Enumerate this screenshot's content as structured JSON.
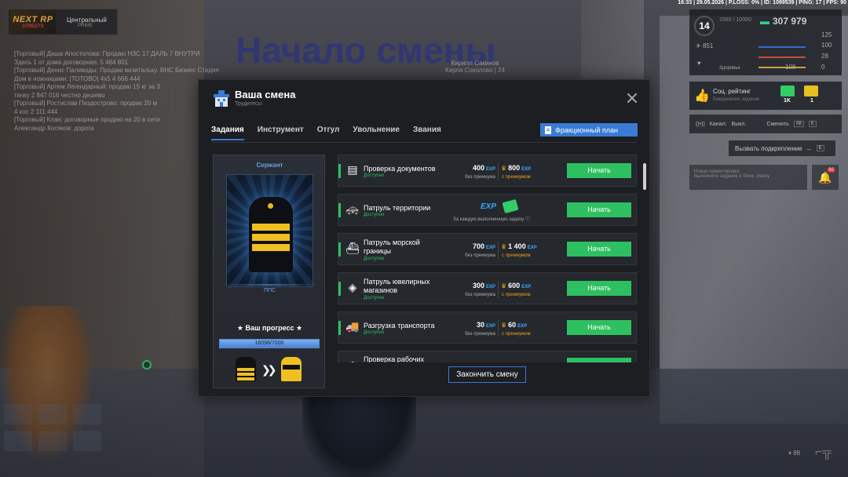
{
  "status_bar": "16:33 | 29.05.2026 | P.LOSS: 0% | ID: 1099539 | PING: 17 | FPS: 90",
  "logo": {
    "line1": "NEXT RP",
    "line2": "STREETS",
    "server": "Центральный",
    "tier": "PRIME"
  },
  "chat": [
    "[Торговый] Даша Апостолова: Продаю НЗС 17 ДАЛЬ 7 ВНУТРИ",
    "Здесь 1 от дома договорная. 5 464 801",
    "[Торговый] Денис Паливоды: Продаю визитальку. ВНС Бизнес Стадия",
    "Дом в ножницами: |ТОТОВО| 4x5 4 666 444",
    "[Торговый] Артем Легендарный: продаю 15 кг за 3",
    "тачку 2 847 016 честно дешево",
    "[Торговый] Ростислав Пиздострово: продаю 20 м",
    "4 кос 2 111 444",
    "[Торговый] Клан: договорные продаю на 20 в сети",
    "Александр Косяков: дорога"
  ],
  "headline": "Начало смены",
  "npc": {
    "name": "Кирилл Сакинов",
    "sub": "Карла Соколово | 24"
  },
  "hud": {
    "level": "14",
    "xp": "1580 / 10000",
    "money": "307 979",
    "stat1": "851",
    "stat2": "125",
    "stat3": "100",
    "stat4": "28",
    "stat5": "108",
    "stat6": "0",
    "stat_label": "Здоровье"
  },
  "social": {
    "title": "Соц. рейтинг",
    "sub": "Ежедневное задание",
    "count1": "1K",
    "count2": "1"
  },
  "radio": {
    "label": "Канал:",
    "value": "Выкл.",
    "change": "Сменить",
    "key1": "Alt",
    "key2": "Е"
  },
  "backup_btn": "Вызвать подкрепление",
  "backup_key": "Е",
  "task_hint": {
    "title": "Новая ориентировка",
    "sub": "Выполните задание в ближ. смену"
  },
  "bell_badge": "92",
  "ammo": "88",
  "modal": {
    "title": "Ваша смена",
    "subtitle": "Трудитесь!",
    "tabs": [
      "Задания",
      "Инструмент",
      "Отгул",
      "Увольнение",
      "Звания"
    ],
    "plan_button": "Фракционный план",
    "end_button": "Закончить смену"
  },
  "rank": {
    "title": "Сержант",
    "division": "ППС",
    "progress_label": "★ Ваш прогресс ★",
    "progress_text": "16098/7000",
    "progress_fraction": 1.0
  },
  "tasks": [
    {
      "name": "Проверка документов",
      "status": "Доступно",
      "base": "400",
      "base_label": "без премиума",
      "premium": "800",
      "premium_label": "с премиумом",
      "button": "Начать",
      "icon": "passport-icon"
    },
    {
      "name": "Патруль территории",
      "status": "Доступно",
      "reward_label": "За каждую выполненную задачу",
      "exp_label": "EXP",
      "button": "Начать",
      "icon": "car-icon"
    },
    {
      "name": "Патруль морской границы",
      "status": "Доступно",
      "base": "700",
      "base_label": "без премиума",
      "premium": "1 400",
      "premium_label": "с премиумом",
      "button": "Начать",
      "icon": "boat-icon"
    },
    {
      "name": "Патруль ювелирных магазинов",
      "status": "Доступно",
      "base": "300",
      "base_label": "без премиума",
      "premium": "600",
      "premium_label": "с премиумом",
      "button": "Начать",
      "icon": "diamond-icon"
    },
    {
      "name": "Разгрузка транспорта",
      "status": "Доступно",
      "base": "30",
      "base_label": "без премиума",
      "premium": "60",
      "premium_label": "с премиумом",
      "button": "Начать",
      "icon": "forklift-icon"
    },
    {
      "name": "Проверка рабочих",
      "status": "",
      "button": "",
      "icon": "worker-icon"
    }
  ],
  "exp_tag": "EXP",
  "colors": {
    "accent_blue": "#3a7bd5",
    "start_green": "#2ec060",
    "premium_gold": "#e8a020",
    "rank_gold": "#f0c020"
  }
}
